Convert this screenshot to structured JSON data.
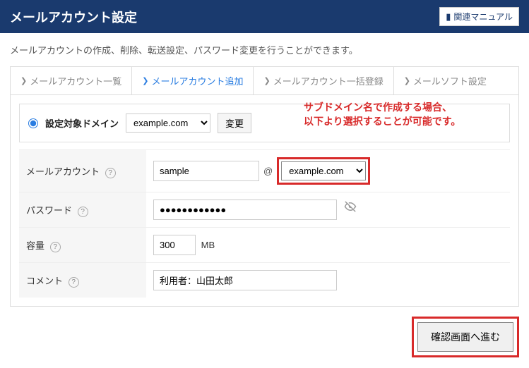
{
  "header": {
    "title": "メールアカウント設定",
    "manual_label": "関連マニュアル"
  },
  "description": "メールアカウントの作成、削除、転送設定、パスワード変更を行うことができます。",
  "tabs": [
    {
      "label": "メールアカウント一覧"
    },
    {
      "label": "メールアカウント追加"
    },
    {
      "label": "メールアカウント一括登録"
    },
    {
      "label": "メールソフト設定"
    }
  ],
  "domain_row": {
    "label": "設定対象ドメイン",
    "selected": "example.com",
    "change_label": "変更"
  },
  "annotation": "サブドメイン名で作成する場合、\n以下より選択することが可能です。",
  "fields": {
    "account": {
      "label": "メールアカウント",
      "value": "sample",
      "domain_selected": "example.com"
    },
    "password": {
      "label": "パスワード",
      "value": "●●●●●●●●●●●●"
    },
    "capacity": {
      "label": "容量",
      "value": "300",
      "unit": "MB"
    },
    "comment": {
      "label": "コメント",
      "value": "利用者：山田太郎"
    }
  },
  "submit_label": "確認画面へ進む"
}
